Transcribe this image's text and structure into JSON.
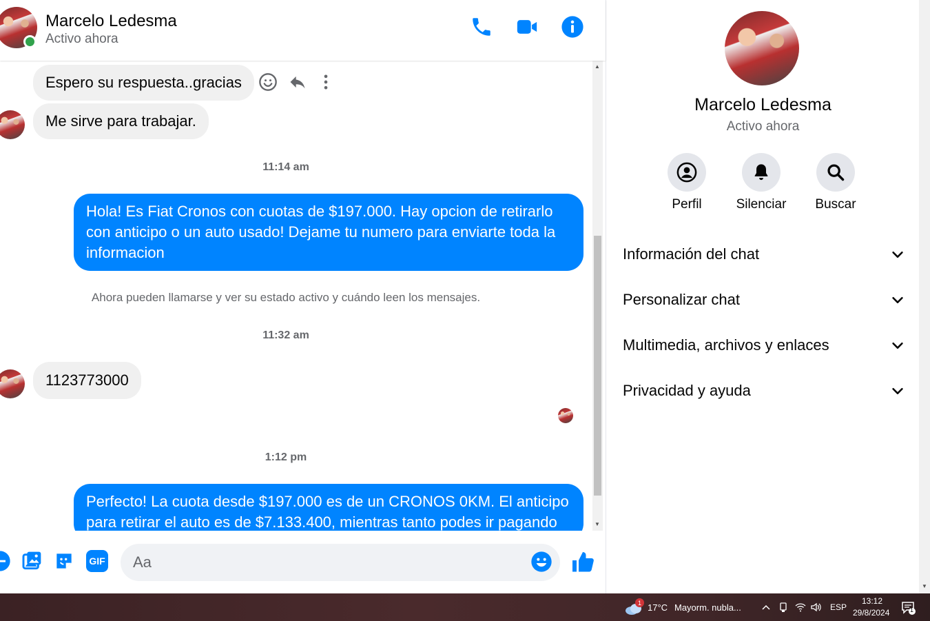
{
  "contact": {
    "name": "Marcelo Ledesma",
    "status": "Activo ahora"
  },
  "header_icons": [
    "phone-icon",
    "video-camera-icon",
    "info-icon"
  ],
  "messages": {
    "m1": "Espero su respuesta..gracias",
    "m2": "Me sirve para trabajar.",
    "ts1": "11:14 am",
    "m3": "Hola! Es Fiat Cronos con cuotas de $197.000. Hay opcion de retirarlo con anticipo o un auto usado! Dejame tu numero para enviarte toda la informacion",
    "system": "Ahora pueden llamarse y ver su estado activo y cuándo leen los mensajes.",
    "ts2": "11:32 am",
    "m4": "1123773000",
    "ts3": "1:12 pm",
    "m5": "Perfecto! La cuota desde $197.000 es de un CRONOS 0KM. El anticipo para retirar el auto es de $7.133.400, mientras tanto podes ir pagando"
  },
  "composer": {
    "placeholder": "Aa",
    "gif_label": "GIF"
  },
  "panel": {
    "buttons": [
      {
        "label": "Perfil",
        "icon": "profile-icon"
      },
      {
        "label": "Silenciar",
        "icon": "bell-icon"
      },
      {
        "label": "Buscar",
        "icon": "search-icon"
      }
    ],
    "sections": [
      "Información del chat",
      "Personalizar chat",
      "Multimedia, archivos y enlaces",
      "Privacidad y ayuda"
    ]
  },
  "taskbar": {
    "weather_badge": "1",
    "temperature": "17°C",
    "weather_text": "Mayorm. nubla...",
    "language": "ESP",
    "time": "13:12",
    "date": "29/8/2024",
    "notification_count": "1"
  },
  "colors": {
    "accent": "#0084ff",
    "incoming_bubble": "#f0f0f0",
    "online": "#31a24c"
  }
}
